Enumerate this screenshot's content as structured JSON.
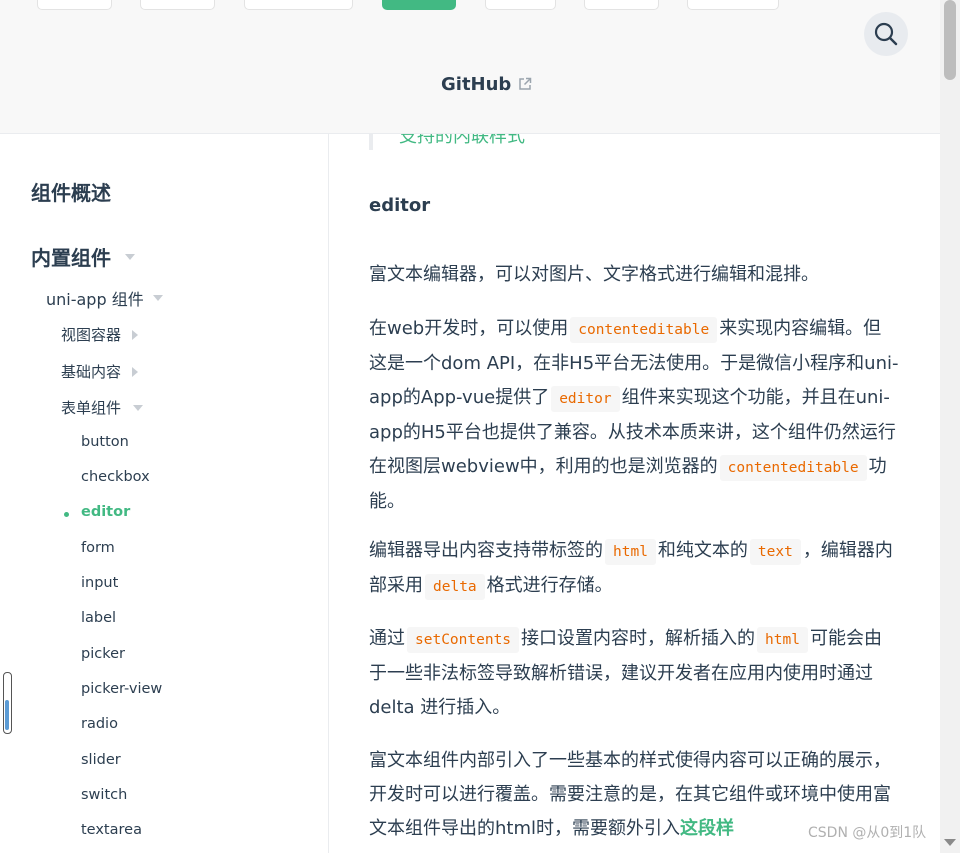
{
  "header": {
    "github_label": "GitHub",
    "external_icon": "external-link-icon",
    "search_icon": "search-icon"
  },
  "sidebar": {
    "overview": "组件概述",
    "builtin": "内置组件",
    "uniapp": "uni-app 组件",
    "view_container": "视图容器",
    "basic_content": "基础内容",
    "form_components": "表单组件",
    "items": [
      "button",
      "checkbox",
      "editor",
      "form",
      "input",
      "label",
      "picker",
      "picker-view",
      "radio",
      "slider",
      "switch",
      "textarea"
    ],
    "active_item": "editor"
  },
  "content": {
    "tip_text": "支持的内联样式",
    "section_title": "editor",
    "p1": "富文本编辑器，可以对图片、文字格式进行编辑和混排。",
    "p2_a": "在web开发时，可以使用",
    "p2_code1": "contenteditable",
    "p2_b": "来实现内容编辑。但这是一个dom API，在非H5平台无法使用。于是微信小程序和uni-app的App-vue提供了",
    "p2_code2": "editor",
    "p2_c": "组件来实现这个功能，并且在uni-app的H5平台也提供了兼容。从技术本质来讲，这个组件仍然运行在视图层webview中，利用的也是浏览器的",
    "p2_code3": "contenteditable",
    "p2_d": "功能。",
    "p3_a": "编辑器导出内容支持带标签的",
    "p3_code1": "html",
    "p3_b": "和纯文本的",
    "p3_code2": "text",
    "p3_c": "，编辑器内部采用",
    "p3_code3": "delta",
    "p3_d": "格式进行存储。",
    "p4_a": "通过",
    "p4_code1": "setContents",
    "p4_b": "接口设置内容时，解析插入的",
    "p4_code2": "html",
    "p4_c": "可能会由于一些非法标签导致解析错误，建议开发者在应用内使用时通过 delta 进行插入。",
    "p5_a": "富文本组件内部引入了一些基本的样式使得内容可以正确的展示，开发时可以进行覆盖。需要注意的是，在其它组件或环境中使用富文本组件导出的html时，需要额外引入",
    "p5_link": "这段样"
  },
  "watermark": "CSDN @从0到1队"
}
